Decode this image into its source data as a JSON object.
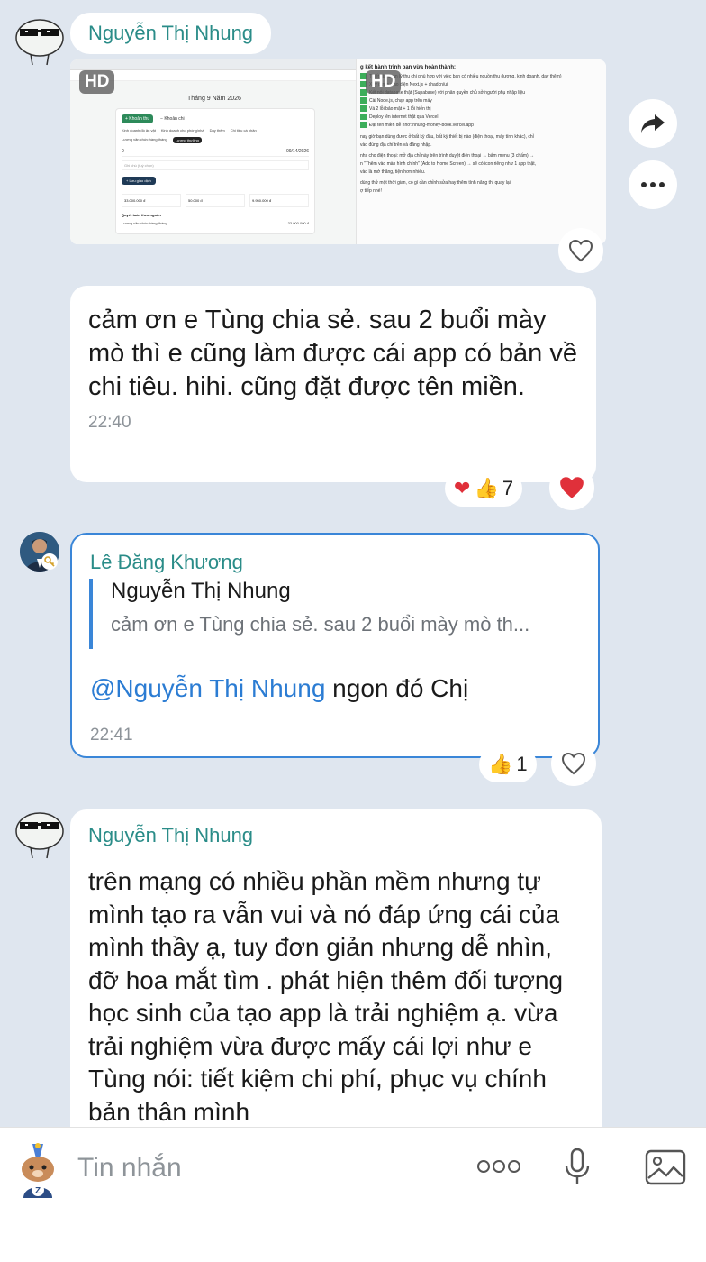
{
  "messages": [
    {
      "sender": "Nguyễn Thị Nhung",
      "media": {
        "hd_label": "HD",
        "preview_right_heading": "g kết hành trình bạn vừa hoàn thành:",
        "checklist": [
          "Thiết lập quản lý thu chi phù hợp với việc bạn có nhiều nguồn thu (lương, kinh doanh, dạy thêm)",
          "Xây dựng giao diện Next.js + shadcn/ui",
          "Kết nối database thật (Supabase) với phân quyền chủ sở/người phụ nhập liệu",
          "Cài Node.js, chạy app trên máy",
          "Vá 2 lỗi bảo mật + 1 lỗi hiển thị",
          "Deploy lên internet thật qua Vercel",
          "Đặt tên miền dễ nhớ: nhung-money-book.vercel.app"
        ],
        "preview_notes": [
          "nay giờ bạn dùng được ở bất kỳ đâu, bất kỳ thiết bị nào (điện thoại, máy tính khác), chỉ",
          "vào đúng địa chỉ trên và đăng nhập.",
          "nhs cho điện thoại: mở địa chỉ này trên trình duyệt điện thoại → bấm menu (3 chấm) →",
          "n \"Thêm vào màn hình chính\" (Add to Home Screen) → sẽ có icon riêng như 1 app thật,",
          "vào là mở thẳng, tiện hơn nhiều.",
          "dùng thử một thời gian, có gì cần chỉnh sửa hay thêm tính năng thì quay lại",
          "ợ tiếp nhé!"
        ],
        "preview_left": {
          "month": "Tháng 9 Năm 2026",
          "tabs": [
            "+ Khoản thu",
            "− Khoản chi"
          ],
          "chips": [
            "Kinh doanh đồ ăn vặt",
            "Kinh doanh cho phòng/nhà",
            "Dạy thêm",
            "Chi tiêu cá nhân"
          ],
          "chips2": [
            "Lương văn chức hàng tháng",
            "Lương thưởng"
          ],
          "amount": "0",
          "date": "09/14/2026",
          "note_placeholder": "Ghi chú (tuỳ chọn)",
          "save_btn": "+ Lưu giao dịch",
          "stats": [
            "33.000.000 đ",
            "50.000 đ",
            "9.950.000 đ"
          ],
          "section": "Quyết toán theo nguồn",
          "row_label": "Lương văn chức hàng tháng",
          "row_value": "33.000.000 đ"
        }
      }
    },
    {
      "text": "cảm ơn e Tùng chia sẻ. sau 2 buổi mày mò thì e cũng làm được cái app có bản về chi tiêu. hihi. cũng đặt được tên miền.",
      "time": "22:40",
      "reactions_count": "7"
    },
    {
      "sender": "Lê Đăng Khương",
      "quote_sender": "Nguyễn Thị Nhung",
      "quote_text": "cảm ơn e Tùng chia sẻ. sau 2 buổi mày mò th...",
      "mention": "@Nguyễn Thị Nhung",
      "text": " ngon đó Chị",
      "time": "22:41",
      "reactions_count": "1"
    },
    {
      "sender": "Nguyễn Thị Nhung",
      "text": "trên mạng có nhiều phần mềm nhưng tự mình tạo ra vẫn vui và nó đáp ứng cái của mình thầy ạ, tuy đơn giản nhưng dễ nhìn, đỡ hoa mắt tìm . phát hiện thêm đối tượng học sinh của tạo app là trải nghiệm ạ. vừa trải nghiệm vừa được mấy cái lợi như e Tùng nói: tiết kiệm chi phí, phục vụ chính bản thân mình"
    }
  ],
  "composer": {
    "placeholder": "Tin nhắn"
  }
}
